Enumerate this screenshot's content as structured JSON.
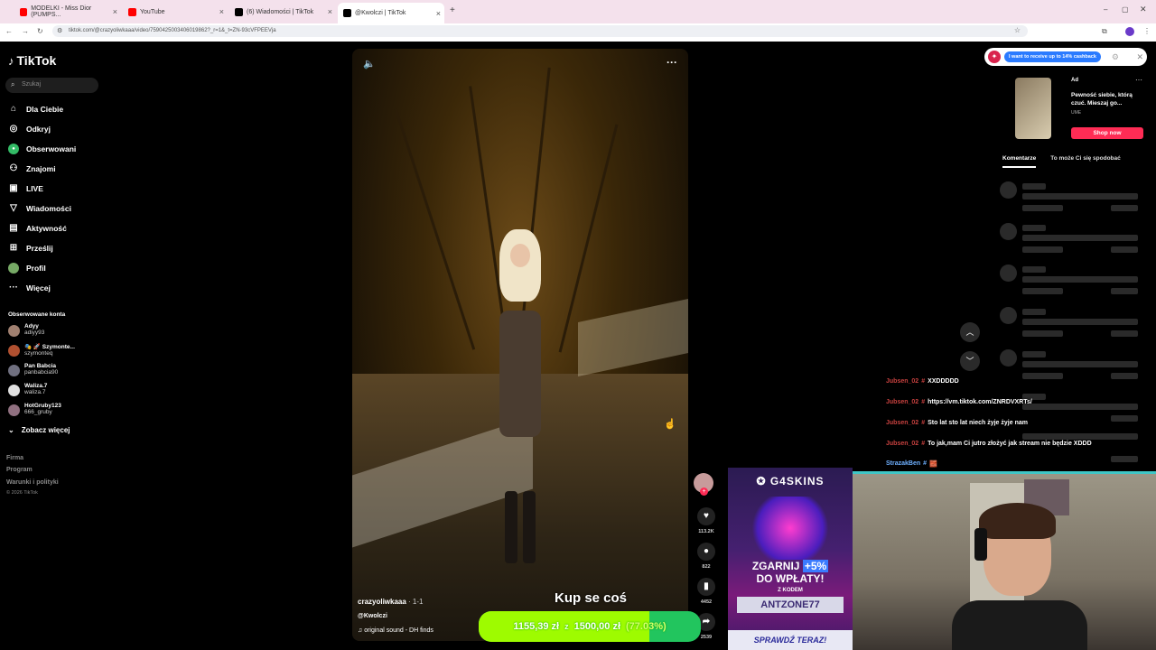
{
  "browser": {
    "tabs": [
      {
        "label": "MODELKI - Miss Dior (PUMPS...",
        "icon": "youtube-icon",
        "color": "#ff0000"
      },
      {
        "label": "YouTube",
        "icon": "youtube-icon",
        "color": "#ff0000"
      },
      {
        "label": "(6) Wiadomości | TikTok",
        "icon": "tiktok-icon",
        "color": "#000000"
      },
      {
        "label": "@Kwolczi | TikTok",
        "icon": "tiktok-icon",
        "color": "#000000"
      }
    ],
    "url": "tiktok.com/@crazyoliwkaaa/video/7590425003406019862?_r=1&_t=ZN-93cVFPEEVja"
  },
  "sidebar": {
    "logo": "TikTok",
    "search_placeholder": "Szukaj",
    "nav": [
      {
        "label": "Dla Ciebie",
        "icon": "home-icon"
      },
      {
        "label": "Odkryj",
        "icon": "compass-icon"
      },
      {
        "label": "Obserwowani",
        "icon": "following-icon"
      },
      {
        "label": "Znajomi",
        "icon": "friends-icon"
      },
      {
        "label": "LIVE",
        "icon": "live-icon"
      },
      {
        "label": "Wiadomości",
        "icon": "send-icon"
      },
      {
        "label": "Aktywność",
        "icon": "inbox-icon"
      },
      {
        "label": "Prześlij",
        "icon": "upload-icon"
      },
      {
        "label": "Profil",
        "icon": "profile-icon"
      },
      {
        "label": "Więcej",
        "icon": "more-icon"
      }
    ],
    "following_title": "Obserwowane konta",
    "accounts": [
      {
        "name": "Adyy",
        "user": "adiyy93"
      },
      {
        "name": "🎭 🚀 Szymonte...",
        "user": "szymonteq"
      },
      {
        "name": "Pan Babcia",
        "user": "panbabcia90"
      },
      {
        "name": "Waliza.7",
        "user": "waliza.7"
      },
      {
        "name": "HotGruby123",
        "user": "666_gruby"
      }
    ],
    "see_more": "Zobacz więcej",
    "footer": [
      "Firma",
      "Program",
      "Warunki i polityki",
      "© 2026 TikTok"
    ]
  },
  "video": {
    "author": "crazyoliwkaaa",
    "date": "· 1-1",
    "tag": "@Kwolczi",
    "sound": "original sound - DH finds",
    "likes": "113.2K",
    "comments": "822",
    "saves": "4452",
    "shares": "2539"
  },
  "donation": {
    "cta": "Kup se coś",
    "current": "1155,39 zł",
    "separator": "z",
    "goal": "1500,00 zł",
    "percent_label": "(77.03%)",
    "percent": 77.03
  },
  "right": {
    "cashback": "I want to receive up to 14% cashback",
    "ad_label": "Ad",
    "ad_text": "Pewność siebie, którą czuć. Mieszaj go...",
    "ad_brand": "UME",
    "ad_button": "Shop now",
    "tab_comments": "Komentarze",
    "tab_suggested": "To może Ci się spodobać"
  },
  "chat": [
    {
      "user": "Jubsen_02",
      "message": "XXDDDDD"
    },
    {
      "user": "Jubsen_02",
      "message": "https://vm.tiktok.com/ZNRDVXRTs/"
    },
    {
      "user": "Jubsen_02",
      "message": "Sto lat sto lat niech żyje żyje nam"
    },
    {
      "user": "Jubsen_02",
      "message": "To jak,mam Ci jutro złożyć jak stream nie będzie XDDD"
    },
    {
      "user": "StrazakBen",
      "message": "🧱"
    }
  ],
  "sponsor": {
    "brand": "G4SKINS",
    "headline_1": "ZGARNIJ",
    "headline_pct": "+5%",
    "headline_2": "DO WPŁATY!",
    "code_label": "Z KODEM",
    "code": "ANTZONE77",
    "cta": "SPRAWDŹ TERAZ!"
  }
}
